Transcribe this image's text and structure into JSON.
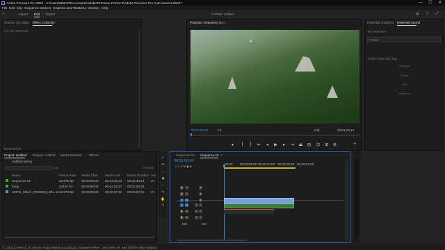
{
  "titlebar": {
    "title": "Adobe Premiere Pro 2023 - C:\\Users\\IBMAP\\Documents\\Adobe\\Premiere Pro\\23.0\\Adobe Premiere Pro Auto-Save\\Untitled *",
    "minimize": "—",
    "maximize": "☐",
    "close": "✕"
  },
  "menu": [
    "File",
    "Edit",
    "Clip",
    "Sequence",
    "Markers",
    "Graphics and Titles",
    "View",
    "Window",
    "Help"
  ],
  "workspace": {
    "tabs": [
      "Import",
      "Edit",
      "Export"
    ],
    "active": "Edit",
    "project_title": "Untitled",
    "edited": "Edited"
  },
  "source_panel": {
    "tabs": [
      "Source: (no clips)",
      "Effect Controls"
    ],
    "menu_icon": "≡",
    "empty_text": "(no clip selected)",
    "timecode": "00:00:00:00"
  },
  "program": {
    "title": "Program: Sequence 01",
    "menu_icon": "≡",
    "timecode_in": "00;00;00;00",
    "fit": "Fit",
    "quality": "Full",
    "duration": "00;01;40;14"
  },
  "essential_graphics": {
    "tabs": [
      "Essential Graphics",
      "Essential Sound"
    ],
    "no_selection": "No Selection",
    "preset_label": "Preset",
    "edit_clips_tag": "Select clips with Tag",
    "buttons": [
      "Dialogue",
      "Music",
      "SFX",
      "Ambience"
    ]
  },
  "project": {
    "tabs": [
      "Project: Untitled",
      "Project: Untitled",
      "Media Browser",
      "Effects"
    ],
    "file": "Untitled.prproj",
    "items_count": "5 items",
    "columns": [
      "Name",
      "Frame Rate",
      "Media Start",
      "Media End",
      "Media Duration",
      "Vid"
    ],
    "rows": [
      {
        "name": "Sequence 01",
        "color": "#3bb03b",
        "rate": "23.976 fps",
        "start": "00;00;00;00",
        "end": "00;01;40;13",
        "duration": "00;01;40;14",
        "vid": "V1"
      },
      {
        "name": "song",
        "color": "#3bb03b",
        "rate": "44100 Hz",
        "start": "00;00;00;00",
        "end": "00;02;35;27",
        "duration": "00;02;35;28",
        "vid": ""
      },
      {
        "name": "AERO_CDSA_RR22004_Wh...m",
        "color": "#5a8fd6",
        "rate": "23.976 fps",
        "start": "00;00;00;00",
        "end": "00;00;07;11",
        "duration": "00;00;07;12",
        "vid": "V1"
      }
    ]
  },
  "timeline": {
    "tabs": [
      "Sequence 01",
      "Sequence 01"
    ],
    "menu_icon": "≡",
    "timecode": "00;00;00;00",
    "ruler": [
      "00;00",
      "00;00;05;00",
      "00;00;10;00",
      "00;00;15;00",
      "00;00;20;00"
    ],
    "tracks": [
      "V3",
      "V2",
      "V1",
      "A1",
      "A2",
      "A3"
    ],
    "mix_label": "Mix",
    "mix_value": "0.0"
  },
  "tools": [
    "▸",
    "⇹",
    "↔",
    "◆",
    "↕",
    "✎",
    "✋",
    "T"
  ],
  "status": "Click to select, or click in empty space and drag to marquee select. Use Shift, Alt, and Ctrl for other options."
}
